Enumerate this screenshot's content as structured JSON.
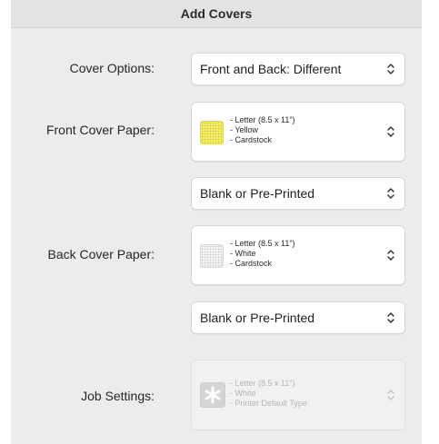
{
  "window": {
    "title": "Add Covers"
  },
  "cover_options": {
    "label": "Cover Options:",
    "value": "Front and Back: Different"
  },
  "front_cover_paper": {
    "label": "Front Cover Paper:",
    "swatch_color": "#f7f170",
    "lines": [
      "- Letter (8.5 x 11\")",
      "- Yellow",
      "- Cardstock"
    ]
  },
  "front_print_mode": {
    "value": "Blank or Pre-Printed"
  },
  "back_cover_paper": {
    "label": "Back Cover Paper:",
    "swatch_color": "#f6f6f6",
    "lines": [
      "- Letter (8.5 x 11\")",
      "- White",
      "- Cardstock"
    ]
  },
  "back_print_mode": {
    "value": "Blank or Pre-Printed"
  },
  "job_settings": {
    "label": "Job Settings:",
    "icon": "asterisk-icon",
    "lines": [
      "- Letter (8.5 x 11\")",
      "- White",
      "- Printer Default Type"
    ]
  }
}
